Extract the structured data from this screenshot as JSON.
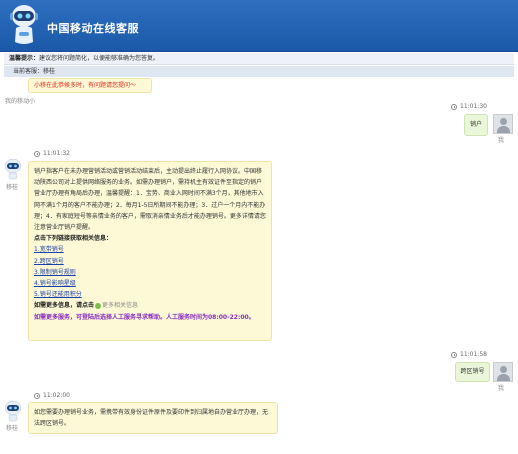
{
  "header": {
    "title": "中国移动在线客服"
  },
  "notice": {
    "label": "温馨提示：",
    "text": "建议您将问题简化，以便能够准确为您答复。"
  },
  "agentbar": {
    "text": "当前客服：移桂"
  },
  "messages": {
    "m0": {
      "agent_name": "我的移动小",
      "text": "小移在此恭候多时，有问题请您提问～"
    },
    "m1": {
      "time": "11:01:30",
      "text": "销户",
      "user_name": "我"
    },
    "m2": {
      "time": "11:01:32",
      "agent_name": "移桂",
      "paragraph": "销户指客户在未办理营销活动或营销活动结束后，主动提出终止履行入网协议。中国移动陕西公司对上提供网络服务的业务。如需办理销户，需持机主有效证件至指定的销户营业厅办理有角局后办理，温馨提醒：1．宝势、商业入网时间不满3个月，其他地市入网不满1个月的客户不能办理；2．每月1-5日所期间不能办理；3．过户一个月内不能办理；4．有家庭短号等亲情业务的客户，需取消亲情业务后才能办理销号。更多详情请您注意营业厅销户提醒。",
      "links_heading": "点击下列链接获取相关信息：",
      "links": [
        "1.宽带销号",
        "2.跨区销号",
        "3.限制销号规则",
        "4.销号影响星级",
        "5.销号还能用积分"
      ],
      "more_label": "如需更多信息，请点击",
      "more_link": "更多相关信息",
      "service_note": "如需更多服务，可登陆后选择人工服务寻求帮助。人工服务时间为08:00-22:00。"
    },
    "m3": {
      "time": "11:01:58",
      "text": "跨区销号",
      "user_name": "我"
    },
    "m4": {
      "time": "11:02:00",
      "agent_name": "移桂",
      "text": "如您需要办理销号业务，需携带有效身份证件原件及要印件到归属地自办营业厅办理，无法跨区销号。"
    }
  }
}
